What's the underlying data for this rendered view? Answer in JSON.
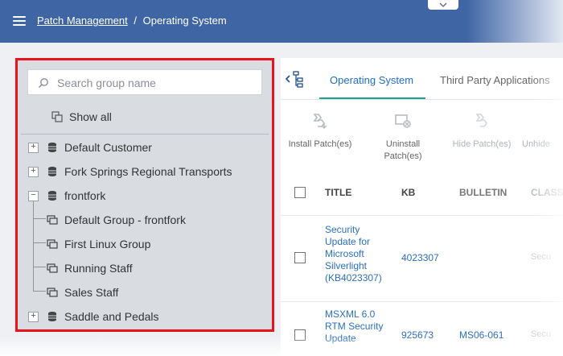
{
  "header": {
    "breadcrumb_link": "Patch Management",
    "breadcrumb_separator": "/",
    "breadcrumb_current": "Operating System"
  },
  "left_panel": {
    "search_placeholder": "Search group name",
    "show_all_label": "Show all",
    "tree": [
      {
        "label": "Default Customer",
        "expander": "+"
      },
      {
        "label": "Fork Springs Regional Transports",
        "expander": "+"
      },
      {
        "label": "frontfork",
        "expander": "−"
      },
      {
        "label": "Default Group - frontfork"
      },
      {
        "label": "First Linux Group"
      },
      {
        "label": "Running Staff"
      },
      {
        "label": "Sales Staff"
      },
      {
        "label": "Saddle and Pedals",
        "expander": "+"
      }
    ]
  },
  "right_panel": {
    "tabs": [
      {
        "label": "Operating System",
        "active": true
      },
      {
        "label": "Third Party Applications",
        "active": false
      }
    ],
    "toolbar": [
      {
        "label": "Install Patch(es)",
        "icon": "install-patch-icon"
      },
      {
        "label": "Uninstall Patch(es)",
        "icon": "uninstall-patch-icon"
      },
      {
        "label": "Hide Patch(es)",
        "icon": "hide-patch-icon"
      },
      {
        "label": "Unhide",
        "icon": "unhide-patch-icon"
      }
    ],
    "columns": [
      "TITLE",
      "KB",
      "BULLETIN",
      "CLASS"
    ],
    "rows": [
      {
        "title": "Security Update for Microsoft Silverlight (KB4023307)",
        "title_lines": [
          "Security",
          "Update for",
          "Microsoft",
          "Silverlight",
          "(KB4023307)"
        ],
        "kb": "4023307",
        "bulletin": "",
        "class": "Secu"
      },
      {
        "title": "MSXML 6.0 RTM Security Update",
        "title_lines": [
          "MSXML 6.0",
          "RTM Security",
          "Update"
        ],
        "kb": "925673",
        "bulletin": "MS06-061",
        "class": "Secu"
      }
    ]
  },
  "colors": {
    "header_bg": "#3f65a5",
    "highlight_border": "#e8141b",
    "link": "#2a6fc2",
    "tab_active": "#1f6fc5",
    "tab_underline": "#19a592"
  }
}
